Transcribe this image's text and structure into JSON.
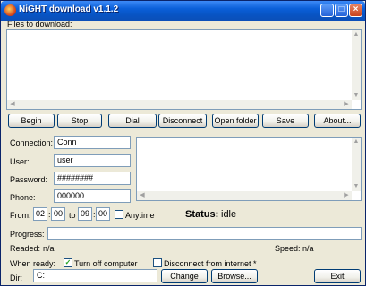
{
  "window": {
    "title": "NiGHT download v1.1.2",
    "minimize_glyph": "_",
    "maximize_glyph": "□",
    "close_glyph": "×"
  },
  "files": {
    "label": "Files to download:",
    "scroll_up": "▲",
    "scroll_down": "▼",
    "scroll_left": "◀",
    "scroll_right": "▶"
  },
  "toolbar": {
    "begin": "Begin",
    "stop": "Stop",
    "dial": "Dial",
    "disconnect": "Disconnect",
    "open_folder": "Open folder",
    "save": "Save",
    "about": "About..."
  },
  "connection": {
    "connection_label": "Connection:",
    "connection_value": "Conn",
    "user_label": "User:",
    "user_value": "user",
    "password_label": "Password:",
    "password_value": "########",
    "phone_label": "Phone:",
    "phone_value": "000000"
  },
  "schedule": {
    "from_label": "From:",
    "from_hour": "02",
    "from_min": "00",
    "to_label": "to",
    "to_hour": "09",
    "to_min": "00",
    "colon": ":",
    "anytime_label": "Anytime",
    "anytime_checked": false
  },
  "status": {
    "label": "Status:",
    "value": "idle",
    "progress_label": "Progress:",
    "progress": 0,
    "readed_label": "Readed:",
    "readed_value": "n/a",
    "speed_label": "Speed:",
    "speed_value": "n/a"
  },
  "options": {
    "when_ready_label": "When ready:",
    "turn_off_label": "Turn off computer",
    "turn_off_checked": true,
    "checkmark": "✓",
    "disconnect_label": "Disconnect from internet *",
    "disconnect_checked": false
  },
  "dir": {
    "label": "Dir:",
    "value": "C:",
    "change": "Change",
    "browse": "Browse...",
    "exit": "Exit"
  }
}
